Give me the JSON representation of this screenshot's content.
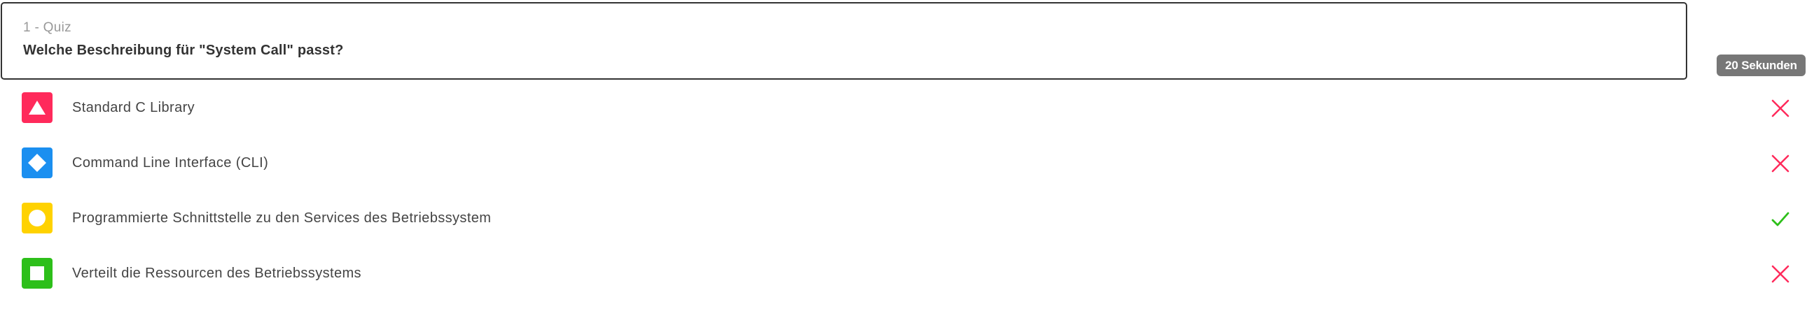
{
  "question": {
    "number_label": "1 - Quiz",
    "text": "Welche Beschreibung für \"System Call\" passt?"
  },
  "timer": {
    "label": "20 Sekunden"
  },
  "answers": [
    {
      "shape": "triangle-icon",
      "color": "#ff2a5b",
      "label": "Standard C Library",
      "result": "incorrect"
    },
    {
      "shape": "diamond-icon",
      "color": "#1b8ff0",
      "label": "Command Line Interface (CLI)",
      "result": "incorrect"
    },
    {
      "shape": "circle-icon",
      "color": "#ffd200",
      "label": "Programmierte Schnittstelle zu den Services des Betriebssystem",
      "result": "correct"
    },
    {
      "shape": "square-icon",
      "color": "#2dbf1a",
      "label": "Verteilt die Ressourcen des Betriebssystems",
      "result": "incorrect"
    }
  ],
  "colors": {
    "incorrect": "#ff2a5b",
    "correct": "#2dbf1a"
  }
}
